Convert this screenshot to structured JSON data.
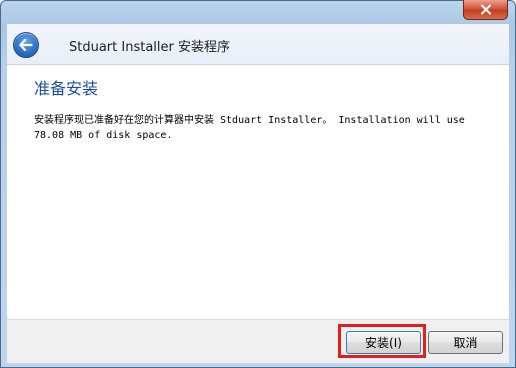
{
  "window": {
    "title": "Stduart Installer 安装程序",
    "close_icon": "close-icon",
    "back_icon": "back-arrow-icon"
  },
  "content": {
    "heading": "准备安装",
    "description": "安装程序现已准备好在您的计算器中安装 Stduart Installer。 Installation will use 78.08 MB of disk space."
  },
  "footer": {
    "install_label": "安装(I)",
    "cancel_label": "取消"
  },
  "colors": {
    "heading": "#1e4f9a",
    "highlight": "#e02020"
  }
}
